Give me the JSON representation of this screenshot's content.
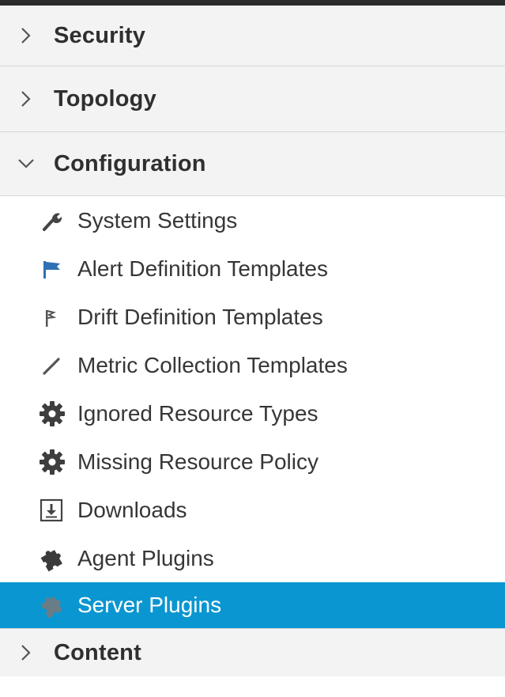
{
  "sections": {
    "security": {
      "label": "Security",
      "expanded": false
    },
    "topology": {
      "label": "Topology",
      "expanded": false
    },
    "configuration": {
      "label": "Configuration",
      "expanded": true,
      "items": [
        {
          "label": "System Settings",
          "icon": "wrench-icon"
        },
        {
          "label": "Alert Definition Templates",
          "icon": "flag-icon"
        },
        {
          "label": "Drift Definition Templates",
          "icon": "drift-flag-icon"
        },
        {
          "label": "Metric Collection Templates",
          "icon": "pencil-icon"
        },
        {
          "label": "Ignored Resource Types",
          "icon": "gear-icon"
        },
        {
          "label": "Missing Resource Policy",
          "icon": "gear-icon"
        },
        {
          "label": "Downloads",
          "icon": "download-icon"
        },
        {
          "label": "Agent Plugins",
          "icon": "puzzle-icon"
        },
        {
          "label": "Server Plugins",
          "icon": "puzzle-icon",
          "selected": true
        }
      ]
    },
    "content": {
      "label": "Content",
      "expanded": false
    }
  },
  "colors": {
    "selected_background": "#0a96d1",
    "header_background": "#f3f3f3",
    "flag_blue": "#2f6fb6"
  }
}
